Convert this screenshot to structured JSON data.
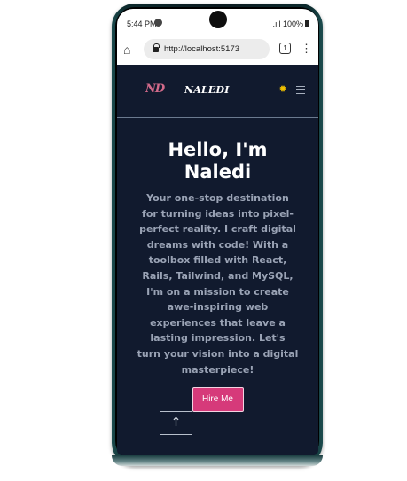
{
  "status_bar": {
    "time": "5:44 PM",
    "battery": "100%",
    "signal": ".ıll"
  },
  "browser": {
    "url": "http://localhost:5173",
    "tab_count": "1",
    "home_glyph": "⌂",
    "menu_glyph": "⋮"
  },
  "nav": {
    "logo": "ND",
    "brand": "NALEDI",
    "theme_icon": "sun-icon",
    "theme_glyph": "✹",
    "accent": "#f0c000"
  },
  "hero": {
    "title": "Hello, I'm Naledi",
    "description": "Your one-stop destination for turning ideas into pixel-perfect reality. I craft digital dreams with code! With a toolbox filled with React, Rails, Tailwind, and MySQL, I'm on a mission to create awe-inspiring web experiences that leave a lasting impression. Let's turn your vision into a digital masterpiece!",
    "cta_label": "Hire Me",
    "cta_color": "#d63a7a"
  },
  "scroll_top": {
    "glyph": "↑"
  },
  "colors": {
    "page_bg": "#111a2e",
    "muted_text": "#9aa3b5"
  }
}
